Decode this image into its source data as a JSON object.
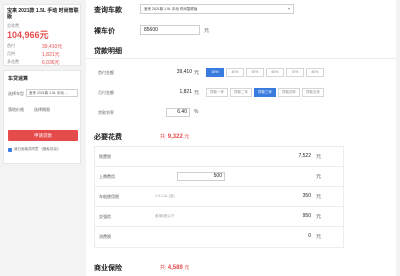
{
  "left": {
    "car_name": "宝来 2021款 1.5L 手动 时尚智联版",
    "total_label": "总花费",
    "total_value": "104,966元",
    "rows": [
      {
        "label": "首付",
        "value": "39,410元"
      },
      {
        "label": "月供",
        "value": "1,821元"
      },
      {
        "label": "多花费",
        "value": "6,036元"
      }
    ],
    "calc": {
      "title": "车贷速算",
      "car_label": "选择车型",
      "car_value": "宝来 2021款 1.5L 手动 ...",
      "price_label": "落地价格",
      "period_label": "选择期限",
      "button_label": "申请贷款",
      "agree_label": "我已阅读并同意 《隐私协议》"
    }
  },
  "right": {
    "model_label": "查询车款",
    "model_value": "宝来 2021款 1.5L 手动 时尚智联版",
    "price_label": "裸车价",
    "price_value": "85600",
    "price_unit": "元",
    "loan_title": "贷款明细",
    "down_label": "首付金额",
    "down_value": "39,410",
    "down_unit": "元",
    "pct_options": [
      "30%",
      "40%",
      "50%",
      "60%",
      "70%",
      "80%"
    ],
    "pct_active": 0,
    "monthly_label": "月付金额",
    "monthly_value": "1,821",
    "monthly_unit": "元",
    "year_options": [
      "贷款一年",
      "贷款二年",
      "贷款三年",
      "贷款四年",
      "贷款五年"
    ],
    "year_active": 2,
    "rate_label": "贷款利率",
    "rate_value": "6.40",
    "rate_unit": "%",
    "required_title": "必要花费",
    "required_total_prefix": "共:",
    "required_total_value": "9,322",
    "required_total_unit": "元",
    "required_rows": [
      {
        "label": "购置税",
        "hint": "",
        "value": "7,522",
        "unit": "元",
        "input": false
      },
      {
        "label": "上牌费用",
        "hint": "",
        "value": "500",
        "unit": "元",
        "input": true
      },
      {
        "label": "车船使用税",
        "hint": "1.0-1.6L (含)",
        "value": "350",
        "unit": "元",
        "input": false
      },
      {
        "label": "交强险",
        "hint": "家用6座以下",
        "value": "950",
        "unit": "元",
        "input": false
      },
      {
        "label": "消费税",
        "hint": "",
        "value": "0",
        "unit": "元",
        "input": false
      }
    ],
    "insurance_title": "商业保险",
    "insurance_total_prefix": "共:",
    "insurance_total_value": "4,589",
    "insurance_total_unit": "元"
  }
}
